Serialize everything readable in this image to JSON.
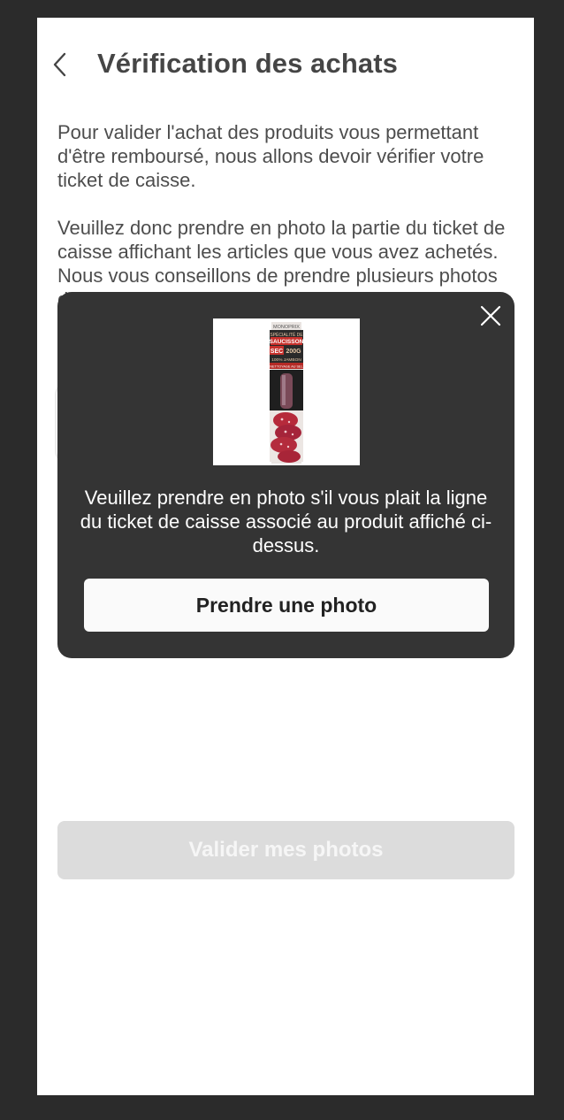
{
  "header": {
    "title": "Vérification des achats",
    "back_icon": "chevron-left-icon"
  },
  "intro": {
    "paragraph_1": "Pour valider l'achat des produits vous permettant d'être remboursé, nous allons devoir vérifier votre ticket de caisse.",
    "paragraph_2": "Veuillez donc prendre en photo la partie du ticket de caisse affichant les articles que vous avez achetés. Nous vous conseillons de prendre plusieurs photos de cette section au lieu de tout faire"
  },
  "photo_slots": [
    {
      "icon": "camera-icon"
    },
    {
      "icon": "camera-icon"
    }
  ],
  "submit_button": {
    "label": "Valider mes photos",
    "state": "disabled",
    "background": "#d3d3d3"
  },
  "modal": {
    "close_icon": "close-icon",
    "product_image": {
      "brand": "MONOPRIX",
      "line_1": "SPÉCIALITÉ DE",
      "line_2": "SAUCISSON",
      "line_3": "SEC",
      "line_4": "200G",
      "line_5": "100% JAMBON",
      "line_6": "NETTOYAGE AU SEL"
    },
    "message": "Veuillez prendre en photo s'il vous plait la ligne du ticket de caisse associé au produit affiché ci-dessus.",
    "action_button": {
      "label": "Prendre une photo"
    },
    "background": "#343434"
  }
}
